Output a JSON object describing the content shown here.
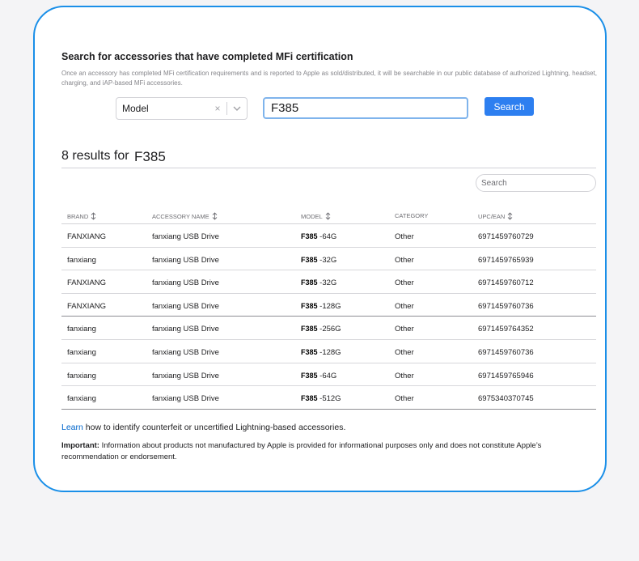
{
  "heading": "Search for accessories that have completed MFi certification",
  "intro": "Once an accessory has completed MFi certification requirements and is reported to Apple as sold/distributed, it will be searchable in our public database of authorized Lightning, headset, charging, and iAP-based MFi accessories.",
  "search": {
    "field_selected": "Model",
    "clear_symbol": "×",
    "query": "F385",
    "button_label": "Search"
  },
  "results": {
    "count_label": "8 results for",
    "term": "F385",
    "filter_placeholder": "Search"
  },
  "table": {
    "headers": [
      "BRAND",
      "ACCESSORY NAME",
      "MODEL",
      "CATEGORY",
      "UPC/EAN"
    ],
    "rows": [
      {
        "brand": "FANXIANG",
        "name": "fanxiang USB Drive",
        "model_prefix": "F385",
        "model_suffix": "-64G",
        "category": "Other",
        "upc": "6971459760729"
      },
      {
        "brand": "fanxiang",
        "name": "fanxiang USB Drive",
        "model_prefix": "F385",
        "model_suffix": "-32G",
        "category": "Other",
        "upc": "6971459765939"
      },
      {
        "brand": "FANXIANG",
        "name": "fanxiang USB Drive",
        "model_prefix": "F385",
        "model_suffix": "-32G",
        "category": "Other",
        "upc": "6971459760712"
      },
      {
        "brand": "FANXIANG",
        "name": "fanxiang USB Drive",
        "model_prefix": "F385",
        "model_suffix": "-128G",
        "category": "Other",
        "upc": "6971459760736"
      },
      {
        "brand": "fanxiang",
        "name": "fanxiang USB Drive",
        "model_prefix": "F385",
        "model_suffix": "-256G",
        "category": "Other",
        "upc": "6971459764352"
      },
      {
        "brand": "fanxiang",
        "name": "fanxiang USB Drive",
        "model_prefix": "F385",
        "model_suffix": "-128G",
        "category": "Other",
        "upc": "6971459760736"
      },
      {
        "brand": "fanxiang",
        "name": "fanxiang USB Drive",
        "model_prefix": "F385",
        "model_suffix": "-64G",
        "category": "Other",
        "upc": "6971459765946"
      },
      {
        "brand": "fanxiang",
        "name": "fanxiang USB Drive",
        "model_prefix": "F385",
        "model_suffix": "-512G",
        "category": "Other",
        "upc": "6975340370745"
      }
    ]
  },
  "footer": {
    "learn_link": "Learn",
    "learn_text": " how to identify counterfeit or uncertified Lightning-based accessories.",
    "important_label": "Important:",
    "important_text": " Information about products not manufactured by Apple is provided for informational purposes only and does not constitute Apple’s recommendation or endorsement."
  },
  "colors": {
    "card_border": "#1a8fe8",
    "button": "#2d7ff0",
    "link": "#0066cc",
    "input_focus": "#7fb4ec"
  },
  "icons": {
    "sort": "sort-arrows-icon",
    "clear": "clear-icon",
    "dropdown": "chevron-down-icon"
  }
}
